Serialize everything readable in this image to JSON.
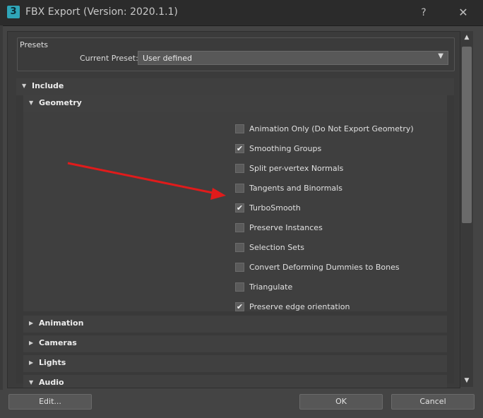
{
  "window": {
    "title": "FBX Export (Version: 2020.1.1)",
    "app_icon_text": "3",
    "help_label": "?",
    "close_label": "✕"
  },
  "presets": {
    "group_title": "Presets",
    "current_preset_label": "Current Preset:",
    "current_preset_value": "User defined"
  },
  "sections": {
    "include": "Include",
    "geometry": "Geometry",
    "animation": "Animation",
    "cameras": "Cameras",
    "lights": "Lights",
    "audio": "Audio"
  },
  "geometry_options": [
    {
      "label": "Animation Only (Do Not Export Geometry)",
      "checked": false
    },
    {
      "label": "Smoothing Groups",
      "checked": true
    },
    {
      "label": "Split per-vertex Normals",
      "checked": false
    },
    {
      "label": "Tangents and Binormals",
      "checked": false
    },
    {
      "label": "TurboSmooth",
      "checked": true
    },
    {
      "label": "Preserve Instances",
      "checked": false
    },
    {
      "label": "Selection Sets",
      "checked": false
    },
    {
      "label": "Convert Deforming Dummies to Bones",
      "checked": false
    },
    {
      "label": "Triangulate",
      "checked": false
    },
    {
      "label": "Preserve edge orientation",
      "checked": true
    }
  ],
  "buttons": {
    "edit": "Edit...",
    "ok": "OK",
    "cancel": "Cancel"
  },
  "colors": {
    "annotation_arrow": "#e01b1b",
    "app_icon": "#2fa5b8"
  }
}
